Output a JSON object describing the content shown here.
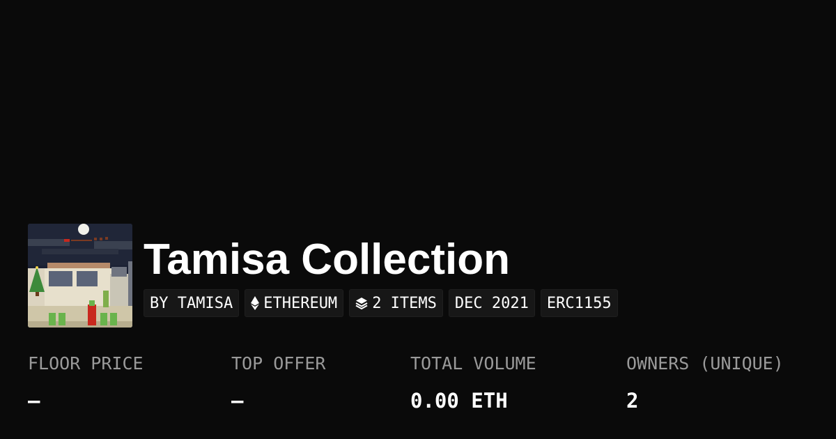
{
  "collection": {
    "name": "Tamisa Collection",
    "image_alt": "Tamisa Collection artwork"
  },
  "tags": {
    "creator": "BY TAMISA",
    "chain": "ETHEREUM",
    "items": "2 ITEMS",
    "date": "DEC 2021",
    "standard": "ERC1155"
  },
  "icons": {
    "chain": "ethereum-icon",
    "items": "layers-icon"
  },
  "stats": {
    "floor_price": {
      "label": "FLOOR PRICE",
      "value": "–"
    },
    "top_offer": {
      "label": "TOP OFFER",
      "value": "–"
    },
    "total_volume": {
      "label": "TOTAL VOLUME",
      "value": "0.00 ETH"
    },
    "owners": {
      "label": "OWNERS (UNIQUE)",
      "value": "2"
    }
  },
  "colors": {
    "background": "#0a0a0a",
    "tag_background": "#171717",
    "label_gray": "#9a9a9a",
    "text": "#ffffff"
  }
}
